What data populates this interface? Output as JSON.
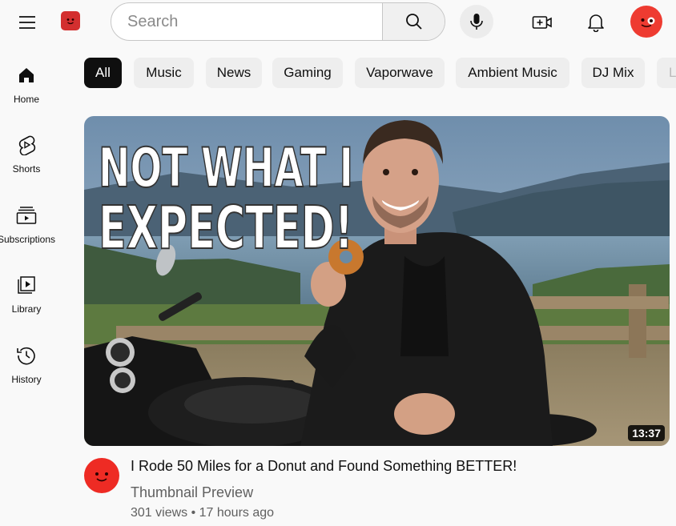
{
  "header": {
    "search_placeholder": "Search",
    "icons": [
      "menu-icon",
      "logo-icon",
      "search-icon",
      "mic-icon",
      "create-icon",
      "bell-icon",
      "avatar-icon"
    ],
    "brand_color": "#ee3b31"
  },
  "sidebar": {
    "items": [
      {
        "label": "Home",
        "icon": "home-icon"
      },
      {
        "label": "Shorts",
        "icon": "shorts-icon"
      },
      {
        "label": "Subscriptions",
        "icon": "subscriptions-icon"
      },
      {
        "label": "Library",
        "icon": "library-icon"
      },
      {
        "label": "History",
        "icon": "history-icon"
      }
    ]
  },
  "chips": {
    "items": [
      "All",
      "Music",
      "News",
      "Gaming",
      "Vaporwave",
      "Ambient Music",
      "DJ Mix",
      "L"
    ],
    "selected": "All"
  },
  "video": {
    "thumbnail_text_line1": "NOT WHAT I",
    "thumbnail_text_line2": "EXPECTED!",
    "duration": "13:37",
    "title": "I Rode 50 Miles for a Donut and Found Something BETTER!",
    "channel": "Thumbnail Preview",
    "stats": "301 views • 17 hours ago"
  }
}
